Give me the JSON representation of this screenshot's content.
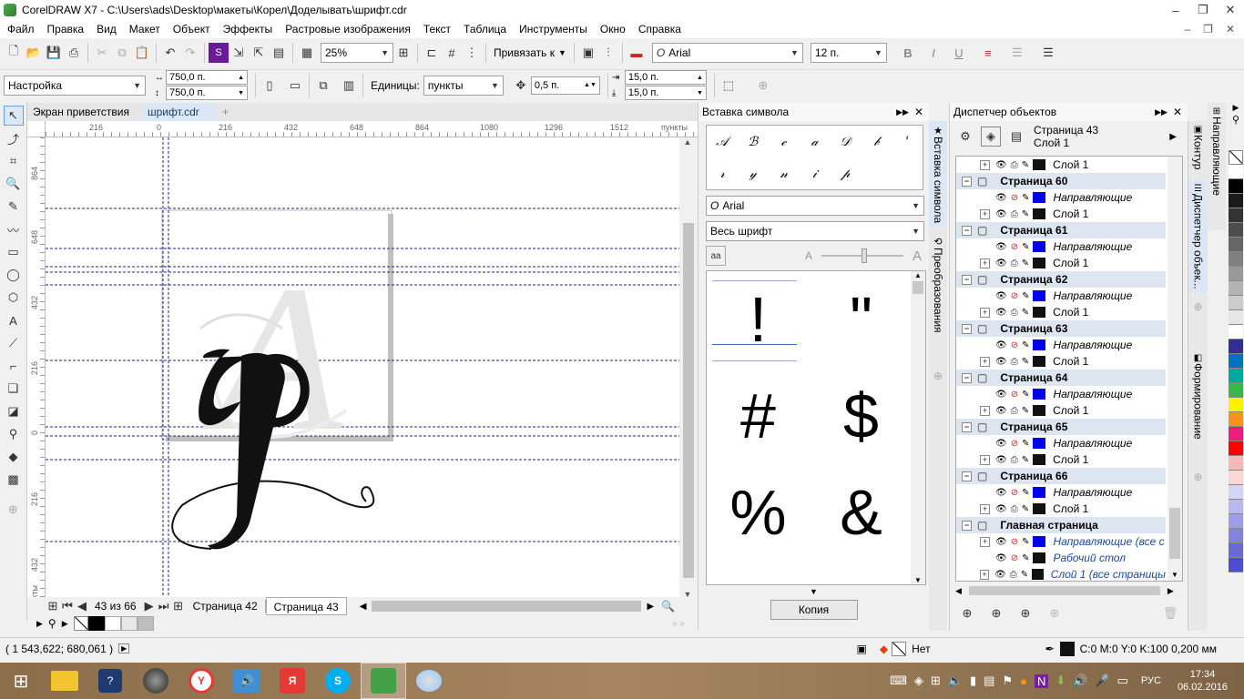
{
  "window": {
    "title": "CorelDRAW X7 - C:\\Users\\ads\\Desktop\\макеты\\Корел\\Доделывать\\шрифт.cdr",
    "controls": {
      "minimize": "‒",
      "maximize": "❐",
      "close": "✕"
    }
  },
  "menu": [
    "Файл",
    "Правка",
    "Вид",
    "Макет",
    "Объект",
    "Эффекты",
    "Растровые изображения",
    "Текст",
    "Таблица",
    "Инструменты",
    "Окно",
    "Справка"
  ],
  "standard_toolbar": {
    "zoom": "25%",
    "snap_label": "Привязать к",
    "font_name": "Arial",
    "font_size": "12 п."
  },
  "property_bar": {
    "preset": "Настройка",
    "width": "750,0 п.",
    "height": "750,0 п.",
    "units_label": "Единицы:",
    "units_value": "пункты",
    "nudge": "0,5 п.",
    "dup_x": "15,0 п.",
    "dup_y": "15,0 п."
  },
  "doc_tabs": {
    "welcome": "Экран приветствия",
    "file": "шрифт.cdr"
  },
  "ruler": {
    "h_ticks": [
      "216",
      "0",
      "216",
      "432",
      "648",
      "864",
      "1080",
      "1296",
      "1512"
    ],
    "h_unit": "пункты",
    "v_ticks": [
      "864",
      "648",
      "432",
      "216",
      "0",
      "216",
      "432"
    ],
    "v_unit": "пункты"
  },
  "page_nav": {
    "counter": "43 из 66",
    "tabs": [
      "Страница 42",
      "Страница 43"
    ]
  },
  "insert_symbol": {
    "title": "Вставка символа",
    "font": "Arial",
    "subset": "Весь шрифт",
    "preview_glyphs": [
      "𝒜",
      "ℬ",
      "𝒸",
      "𝒶",
      "𝒟",
      "𝒷",
      "ꞌ",
      "𝓇",
      "𝓎",
      "𝓃",
      "𝒾",
      "𝓅"
    ],
    "grid_glyphs": [
      "!",
      "\"",
      "#",
      "$",
      "%",
      "&"
    ],
    "copy_button": "Копия"
  },
  "side_tabs": {
    "left": [
      "Вставка символа",
      "Преобразования"
    ],
    "right": [
      "Контур",
      "Диспетчер объек...",
      "Формирование"
    ],
    "far_right": "Направляющие"
  },
  "object_manager": {
    "title": "Диспетчер объектов",
    "current_page": "Страница 43",
    "current_layer": "Слой 1",
    "rows": [
      {
        "type": "layer",
        "label": "Слой 1",
        "color": "#111111"
      },
      {
        "type": "page",
        "label": "Страница 60"
      },
      {
        "type": "guides",
        "label": "Направляющие",
        "color": "#0000ee"
      },
      {
        "type": "layer",
        "label": "Слой 1",
        "color": "#111111"
      },
      {
        "type": "page",
        "label": "Страница 61"
      },
      {
        "type": "guides",
        "label": "Направляющие",
        "color": "#0000ee"
      },
      {
        "type": "layer",
        "label": "Слой 1",
        "color": "#111111"
      },
      {
        "type": "page",
        "label": "Страница 62"
      },
      {
        "type": "guides",
        "label": "Направляющие",
        "color": "#0000ee"
      },
      {
        "type": "layer",
        "label": "Слой 1",
        "color": "#111111"
      },
      {
        "type": "page",
        "label": "Страница 63"
      },
      {
        "type": "guides",
        "label": "Направляющие",
        "color": "#0000ee"
      },
      {
        "type": "layer",
        "label": "Слой 1",
        "color": "#111111"
      },
      {
        "type": "page",
        "label": "Страница 64"
      },
      {
        "type": "guides",
        "label": "Направляющие",
        "color": "#0000ee"
      },
      {
        "type": "layer",
        "label": "Слой 1",
        "color": "#111111"
      },
      {
        "type": "page",
        "label": "Страница 65"
      },
      {
        "type": "guides",
        "label": "Направляющие",
        "color": "#0000ee"
      },
      {
        "type": "layer",
        "label": "Слой 1",
        "color": "#111111"
      },
      {
        "type": "page",
        "label": "Страница 66"
      },
      {
        "type": "guides",
        "label": "Направляющие",
        "color": "#0000ee"
      },
      {
        "type": "layer",
        "label": "Слой 1",
        "color": "#111111"
      },
      {
        "type": "page",
        "label": "Главная страница"
      },
      {
        "type": "master-guides",
        "label": "Направляющие (все с",
        "color": "#0000ee"
      },
      {
        "type": "master-desktop",
        "label": "Рабочий стол",
        "color": "#111111"
      },
      {
        "type": "master-layer",
        "label": "Слой 1 (все страницы",
        "color": "#111111"
      }
    ]
  },
  "palette": [
    "#ffffff",
    "#000000",
    "#1a1a1a",
    "#333333",
    "#4d4d4d",
    "#666666",
    "#808080",
    "#999999",
    "#b3b3b3",
    "#cccccc",
    "#e6e6e6",
    "#ffffff",
    "#2e3192",
    "#0071bc",
    "#00a99d",
    "#39b54a",
    "#fff200",
    "#f7931e",
    "#ed1e79",
    "#ff0000",
    "#f9b8b8",
    "#fcd6d6",
    "#d4d4f5",
    "#b9b9ee",
    "#9e9ee6",
    "#8383de",
    "#6868d6",
    "#4d4dce"
  ],
  "status": {
    "coords": "( 1 543,622; 680,061 )",
    "fill_label": "Нет",
    "outline_label": "C:0 M:0 Y:0 K:100  0,200 мм"
  },
  "taskbar": {
    "lang": "РУС",
    "time": "17:34",
    "date": "06.02.2016"
  }
}
